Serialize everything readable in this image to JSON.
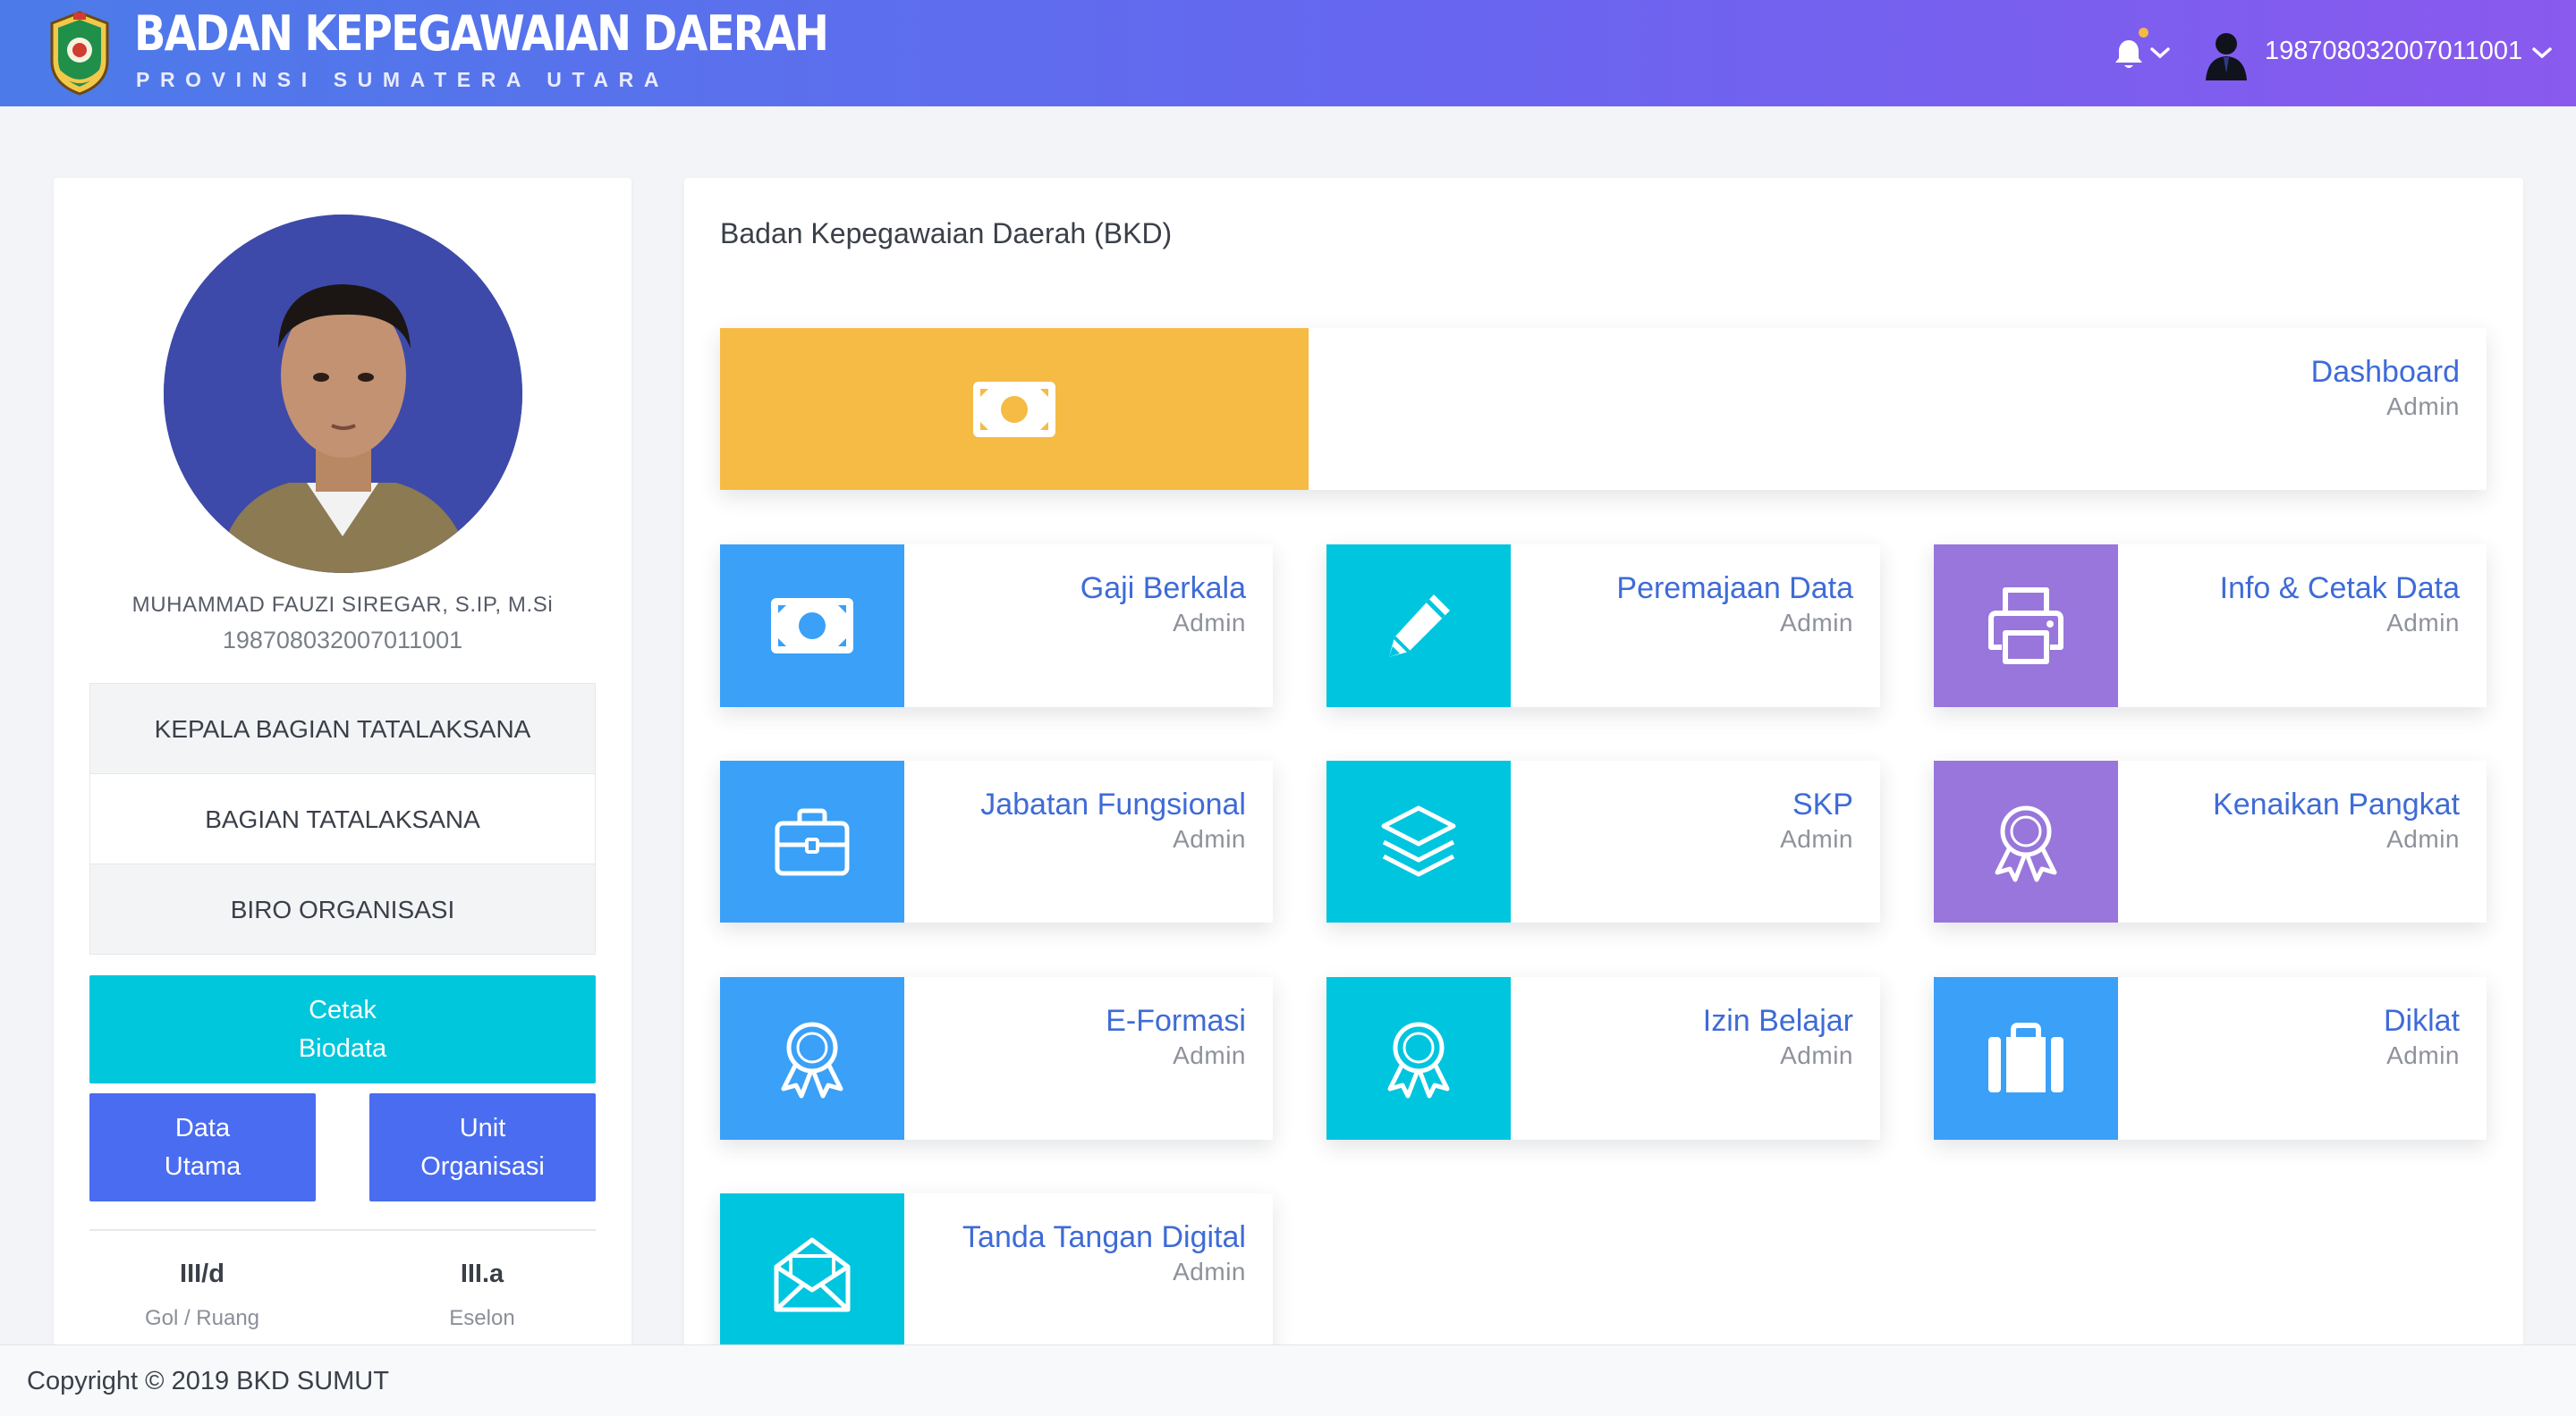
{
  "header": {
    "title": "BADAN KEPEGAWAIAN DAERAH",
    "subtitle": "PROVINSI SUMATERA UTARA",
    "user_id": "198708032007011001",
    "notification_dot_color": "#f5b942",
    "gradient": [
      "#4c7be9",
      "#6766f0",
      "#8a59ee"
    ]
  },
  "profile": {
    "name": "MUHAMMAD FAUZI SIREGAR, S.IP, M.Si",
    "nip": "198708032007011001",
    "rows": [
      "KEPALA BAGIAN TATALAKSANA",
      "BAGIAN TATALAKSANA",
      "BIRO ORGANISASI"
    ],
    "buttons": {
      "cetak": {
        "line1": "Cetak",
        "line2": "Biodata"
      },
      "data_utama": {
        "line1": "Data",
        "line2": "Utama"
      },
      "unit_organisasi": {
        "line1": "Unit",
        "line2": "Organisasi"
      }
    },
    "stats": [
      {
        "value": "III/d",
        "label": "Gol / Ruang"
      },
      {
        "value": "III.a",
        "label": "Eselon"
      }
    ]
  },
  "main": {
    "title": "Badan Kepegawaian Daerah (BKD)",
    "tiles": [
      {
        "label": "Dashboard",
        "sub": "Admin",
        "icon": "money-bill-icon",
        "color": "#f5bb45"
      },
      {
        "label": "Gaji Berkala",
        "sub": "Admin",
        "icon": "money-bill-icon",
        "color": "#3aa0f8"
      },
      {
        "label": "Peremajaan Data",
        "sub": "Admin",
        "icon": "pencil-icon",
        "color": "#00c5df"
      },
      {
        "label": "Info & Cetak Data",
        "sub": "Admin",
        "icon": "printer-icon",
        "color": "#9876db"
      },
      {
        "label": "Jabatan Fungsional",
        "sub": "Admin",
        "icon": "briefcase-icon",
        "color": "#3aa0f8"
      },
      {
        "label": "SKP",
        "sub": "Admin",
        "icon": "layers-icon",
        "color": "#00c5df"
      },
      {
        "label": "Kenaikan Pangkat",
        "sub": "Admin",
        "icon": "award-icon",
        "color": "#9876db"
      },
      {
        "label": "E-Formasi",
        "sub": "Admin",
        "icon": "award-icon",
        "color": "#3aa0f8"
      },
      {
        "label": "Izin Belajar",
        "sub": "Admin",
        "icon": "award-icon",
        "color": "#00c5df"
      },
      {
        "label": "Diklat",
        "sub": "Admin",
        "icon": "suitcase-icon",
        "color": "#3aa0f8"
      },
      {
        "label": "Tanda Tangan Digital",
        "sub": "Admin",
        "icon": "envelope-open-icon",
        "color": "#00c5df"
      }
    ]
  },
  "footer": {
    "text": "Copyright © 2019 BKD SUMUT"
  }
}
